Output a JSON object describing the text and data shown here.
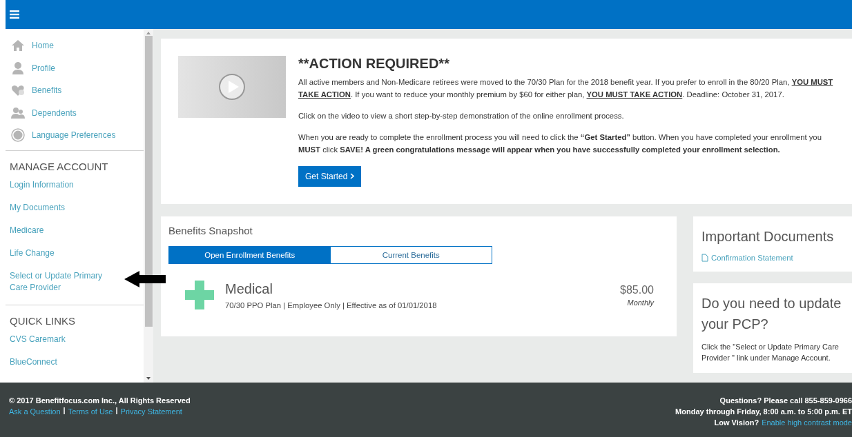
{
  "sidebar": {
    "nav_items": [
      {
        "label": "Home"
      },
      {
        "label": "Profile"
      },
      {
        "label": "Benefits"
      },
      {
        "label": "Dependents"
      },
      {
        "label": "Language Preferences"
      }
    ],
    "sections": [
      {
        "title": "MANAGE ACCOUNT",
        "links": [
          "Login Information",
          "My Documents",
          "Medicare",
          "Life Change",
          "Select or Update Primary Care Provider"
        ]
      },
      {
        "title": "QUICK LINKS",
        "links": [
          "CVS Caremark",
          "BlueConnect"
        ]
      }
    ]
  },
  "action_card": {
    "title": "**ACTION REQUIRED**",
    "paragraphs": [
      "All active members and Non-Medicare retirees were moved to the 70/30 Plan for the 2018 benefit year. If you prefer to enroll in the 80/20 Plan, **YOU MUST TAKE ACTION**. If you want to reduce your monthly premium by $60 for either plan, **YOU MUST TAKE ACTION**. Deadline: October 31, 2017.",
      "Click on the video to view a short step-by-step demonstration of the online enrollment process.",
      "When you are ready to complete the enrollment process you will need to click the **“Get Started”** button. When you have completed your enrollment you **MUST** click **SAVE! A green congratulations message will appear when you have successfully completed your enrollment selection.**"
    ],
    "button": "Get Started"
  },
  "snapshot": {
    "title": "Benefits Snapshot",
    "tabs": [
      {
        "label": "Open Enrollment Benefits",
        "selected": true
      },
      {
        "label": "Current Benefits",
        "selected": false
      }
    ],
    "benefit": {
      "name": "Medical",
      "details": "70/30 PPO Plan | Employee Only | Effective as of 01/01/2018",
      "price": "$85.00",
      "period": "Monthly"
    }
  },
  "documents": {
    "title": "Important Documents",
    "links": [
      "Confirmation Statement"
    ]
  },
  "pcp_card": {
    "title": "Do you need to update your PCP?",
    "text": "Click the \"Select or Update Primary Care Provider \" link under Manage Account."
  },
  "footer": {
    "copyright": "© 2017 Benefitfocus.com Inc., All Rights Reserved",
    "links": [
      "Ask a Question",
      "Terms of Use",
      "Privacy Statement"
    ],
    "separators": [
      "|",
      "|"
    ],
    "questions": "Questions? Please call 855-859-0966",
    "hours": "Monday through Friday, 8:00 a.m. to 5:00 p.m. ET",
    "low_vision_label": "Low Vision?",
    "low_vision_link": "Enable high contrast mode"
  }
}
